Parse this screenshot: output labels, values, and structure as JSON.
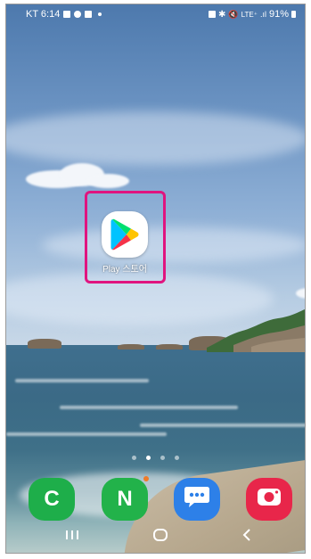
{
  "status_bar": {
    "carrier_time": "KT 6:14",
    "network": "LTE⁺",
    "battery": "91%"
  },
  "home": {
    "highlighted_app": {
      "label": "Play 스토어",
      "icon": "google-play-icon"
    },
    "page_indicator": {
      "pages": 4,
      "active": 2
    }
  },
  "dock": [
    {
      "name": "contacts-app",
      "letter": "C",
      "color": "#1eae4a"
    },
    {
      "name": "naver-app",
      "letter": "N",
      "color": "#22b24a",
      "badge": true
    },
    {
      "name": "messages-app",
      "icon": "chat-bubble-icon",
      "color": "#2d80e8"
    },
    {
      "name": "camera-app",
      "icon": "camera-icon",
      "color": "#e8264a"
    }
  ],
  "nav": {
    "recents": "recents-icon",
    "home": "home-icon",
    "back": "back-icon"
  },
  "colors": {
    "highlight": "#e0147f",
    "notification_dot": "#f07b28"
  }
}
